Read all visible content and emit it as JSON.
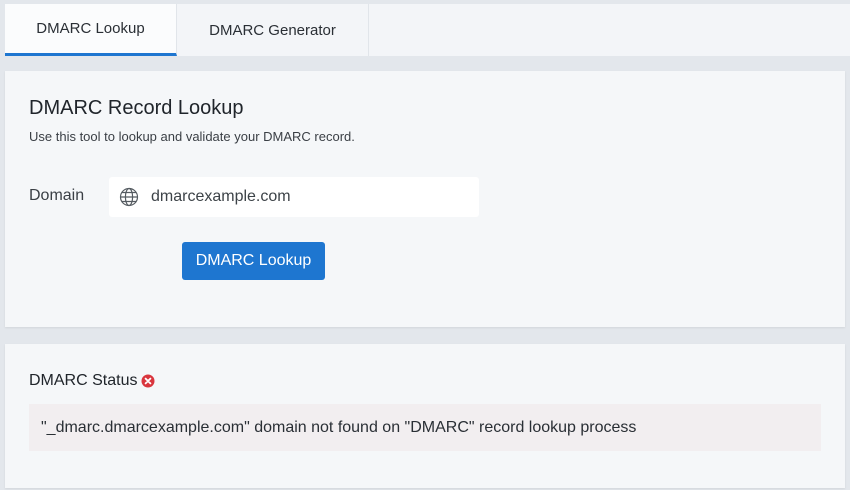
{
  "tabs": [
    {
      "label": "DMARC Lookup",
      "active": true
    },
    {
      "label": "DMARC Generator",
      "active": false
    }
  ],
  "lookup": {
    "title": "DMARC Record Lookup",
    "subtitle": "Use this tool to lookup and validate your DMARC record.",
    "domain_label": "Domain",
    "domain_value": "dmarcexample.com",
    "button_label": "DMARC Lookup"
  },
  "status": {
    "title": "DMARC Status",
    "icon": "error-circle-icon",
    "message": "\"_dmarc.dmarcexample.com\" domain not found on \"DMARC\" record lookup process"
  },
  "colors": {
    "accent": "#1e76d0",
    "error": "#d9363e"
  }
}
